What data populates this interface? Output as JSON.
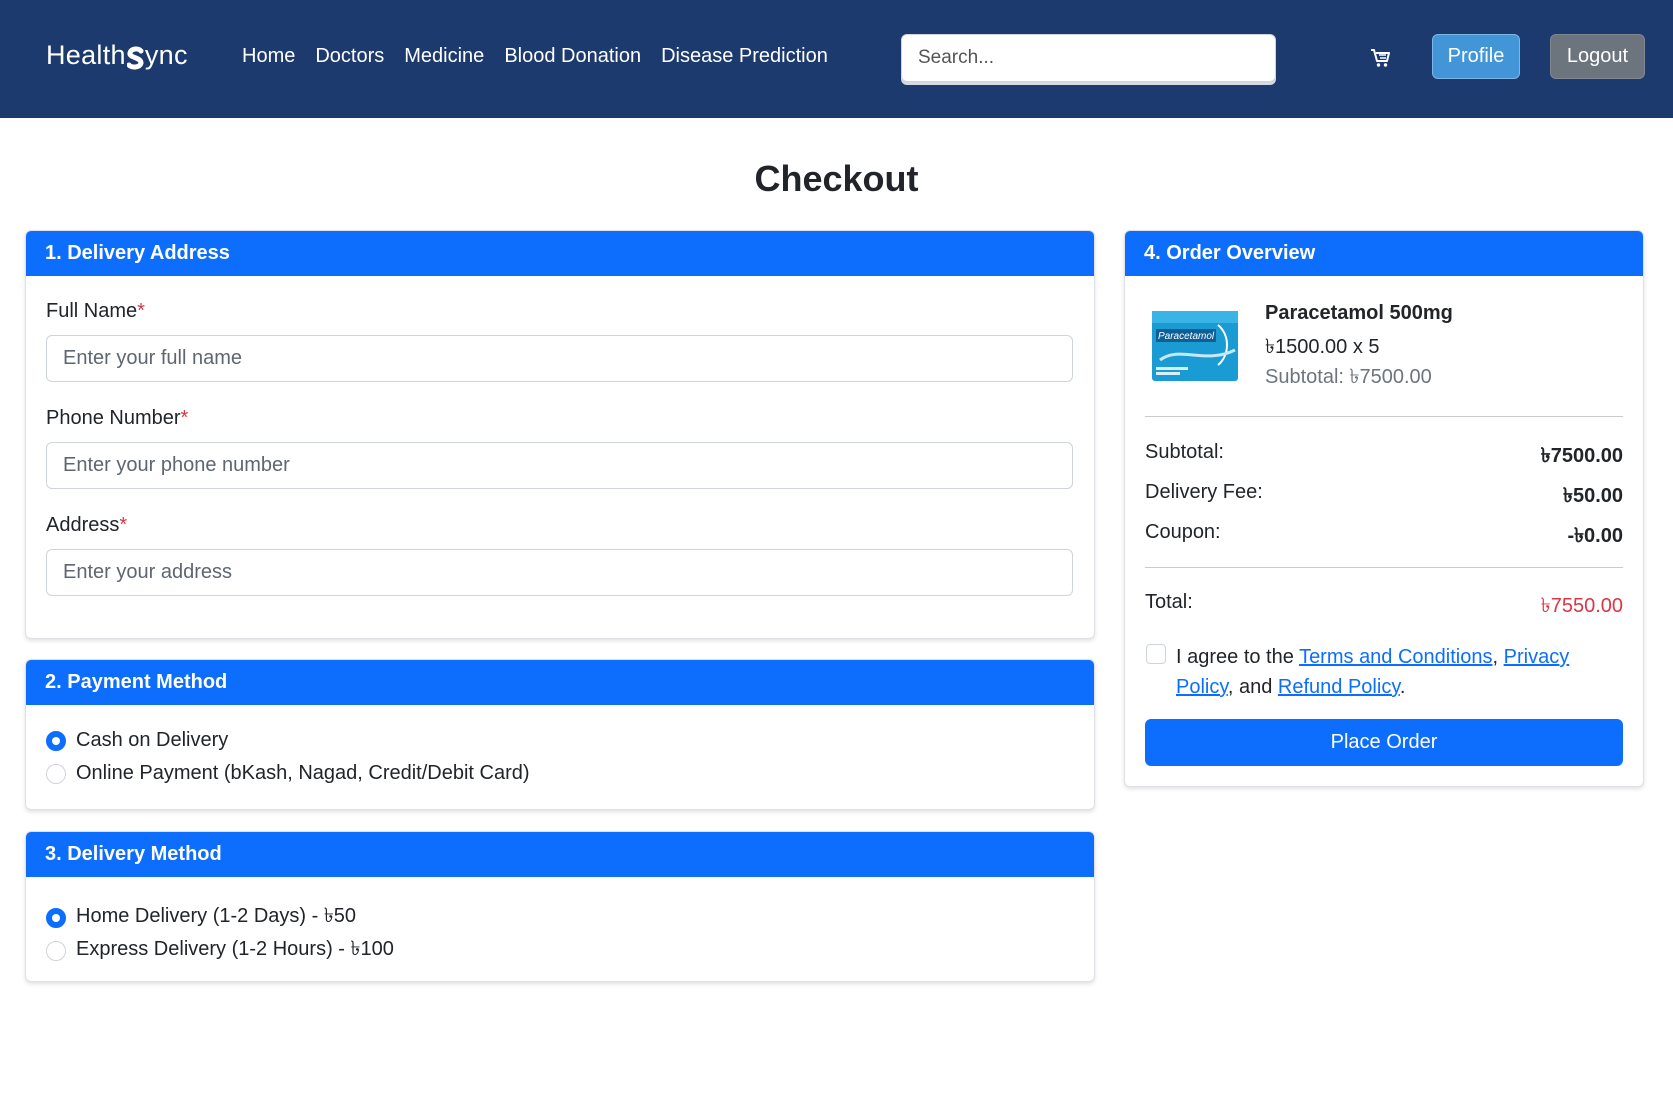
{
  "navbar": {
    "brand_prefix": "Health",
    "brand_suffix": "ync",
    "links": [
      "Home",
      "Doctors",
      "Medicine",
      "Blood Donation",
      "Disease Prediction"
    ],
    "search_placeholder": "Search...",
    "cart_icon": "cart-icon",
    "profile_label": "Profile",
    "logout_label": "Logout",
    "colors": {
      "bar": "#1d3a6e",
      "profile": "#4296d8",
      "logout": "#6c757d"
    }
  },
  "page": {
    "title": "Checkout"
  },
  "address": {
    "header": "1. Delivery Address",
    "full_name_label": "Full Name",
    "full_name_placeholder": "Enter your full name",
    "phone_label": "Phone Number",
    "phone_placeholder": "Enter your phone number",
    "address_label": "Address",
    "address_placeholder": "Enter your address",
    "required_mark": "*"
  },
  "payment": {
    "header": "2. Payment Method",
    "options": [
      "Cash on Delivery",
      "Online Payment (bKash, Nagad, Credit/Debit Card)"
    ],
    "selected": 0
  },
  "delivery": {
    "header": "3. Delivery Method",
    "options": [
      "Home Delivery (1-2 Days) - ৳50",
      "Express Delivery (1-2 Hours) - ৳100"
    ],
    "selected": 0
  },
  "overview": {
    "header": "4. Order Overview",
    "item": {
      "name": "Paracetamol 500mg",
      "price_line": "৳1500.00 x 5",
      "subtotal_line": "Subtotal: ৳7500.00",
      "image_text": "Paracetamol"
    },
    "subtotal_label": "Subtotal:",
    "subtotal_value": "৳7500.00",
    "delivery_label": "Delivery Fee:",
    "delivery_value": "৳50.00",
    "coupon_label": "Coupon:",
    "coupon_value": "-৳0.00",
    "total_label": "Total:",
    "total_value": "৳7550.00",
    "agree_prefix": "I agree to the ",
    "terms_link": "Terms and Conditions",
    "sep1": ", ",
    "privacy_link": "Privacy Policy",
    "sep2": ", and ",
    "refund_link": "Refund Policy",
    "period": ".",
    "place_order_label": "Place Order"
  },
  "colors": {
    "primary": "#0d6efd",
    "danger": "#dc3545"
  }
}
